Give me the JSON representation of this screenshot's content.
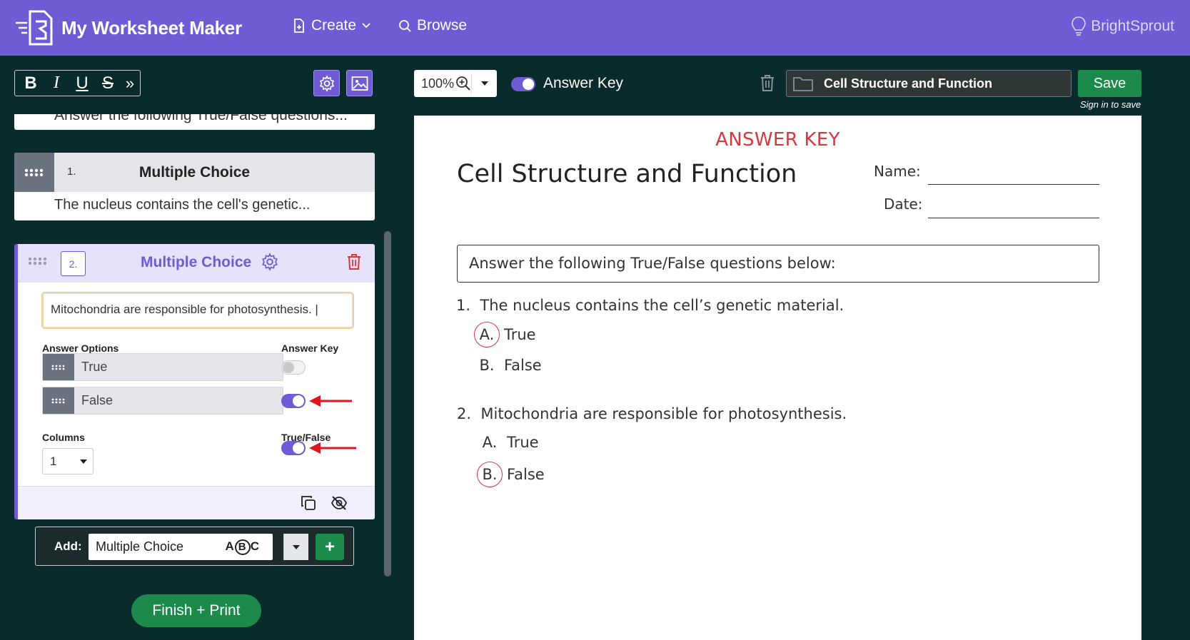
{
  "app": {
    "title": "My Worksheet Maker",
    "brand": "BrightSprout"
  },
  "nav": {
    "create": "Create",
    "browse": "Browse"
  },
  "format_toolbar": {
    "bold": "B",
    "italic": "I",
    "underline": "U",
    "strike": "S",
    "more": "»"
  },
  "editor": {
    "partial_card_text": "Answer the following True/False questions...",
    "card1": {
      "number": "1.",
      "type": "Multiple Choice",
      "question": "The nucleus contains the cell's genetic..."
    },
    "card2": {
      "number": "2.",
      "type": "Multiple Choice",
      "question_value": "Mitochondria are responsible for photosynthesis. |",
      "answer_options_label": "Answer Options",
      "answer_key_label": "Answer Key",
      "options": [
        {
          "text": "True",
          "is_answer": false
        },
        {
          "text": "False",
          "is_answer": true
        }
      ],
      "columns_label": "Columns",
      "columns_value": "1",
      "true_false_label": "True/False",
      "true_false": true
    },
    "add": {
      "label": "Add:",
      "value": "Multiple Choice",
      "abc": [
        "A",
        "B",
        "C"
      ],
      "plus": "+"
    },
    "finish_print": "Finish + Print"
  },
  "toolbar": {
    "zoom": "100%",
    "answer_key_toggle_label": "Answer Key",
    "answer_key_on": true,
    "worksheet_title": "Cell Structure and Function",
    "save": "Save",
    "sign_in": "Sign in to save"
  },
  "worksheet": {
    "answer_key_heading": "ANSWER KEY",
    "title": "Cell Structure and Function",
    "name_label": "Name:",
    "date_label": "Date:",
    "instructions": "Answer the following True/False questions below:",
    "questions": [
      {
        "number": "1.",
        "text": "The nucleus contains the cell’s genetic material.",
        "answers": [
          {
            "letter": "A.",
            "text": "True",
            "correct": true
          },
          {
            "letter": "B.",
            "text": "False",
            "correct": false
          }
        ]
      },
      {
        "number": "2.",
        "text": "Mitochondria are responsible for photosynthesis.",
        "answers": [
          {
            "letter": "A.",
            "text": "True",
            "correct": false
          },
          {
            "letter": "B.",
            "text": "False",
            "correct": true
          }
        ]
      }
    ]
  },
  "colors": {
    "nav": "#6f5bd4",
    "background": "#0a2b2b",
    "accent_green": "#1b8a4b",
    "answer_red": "#d9363e"
  }
}
